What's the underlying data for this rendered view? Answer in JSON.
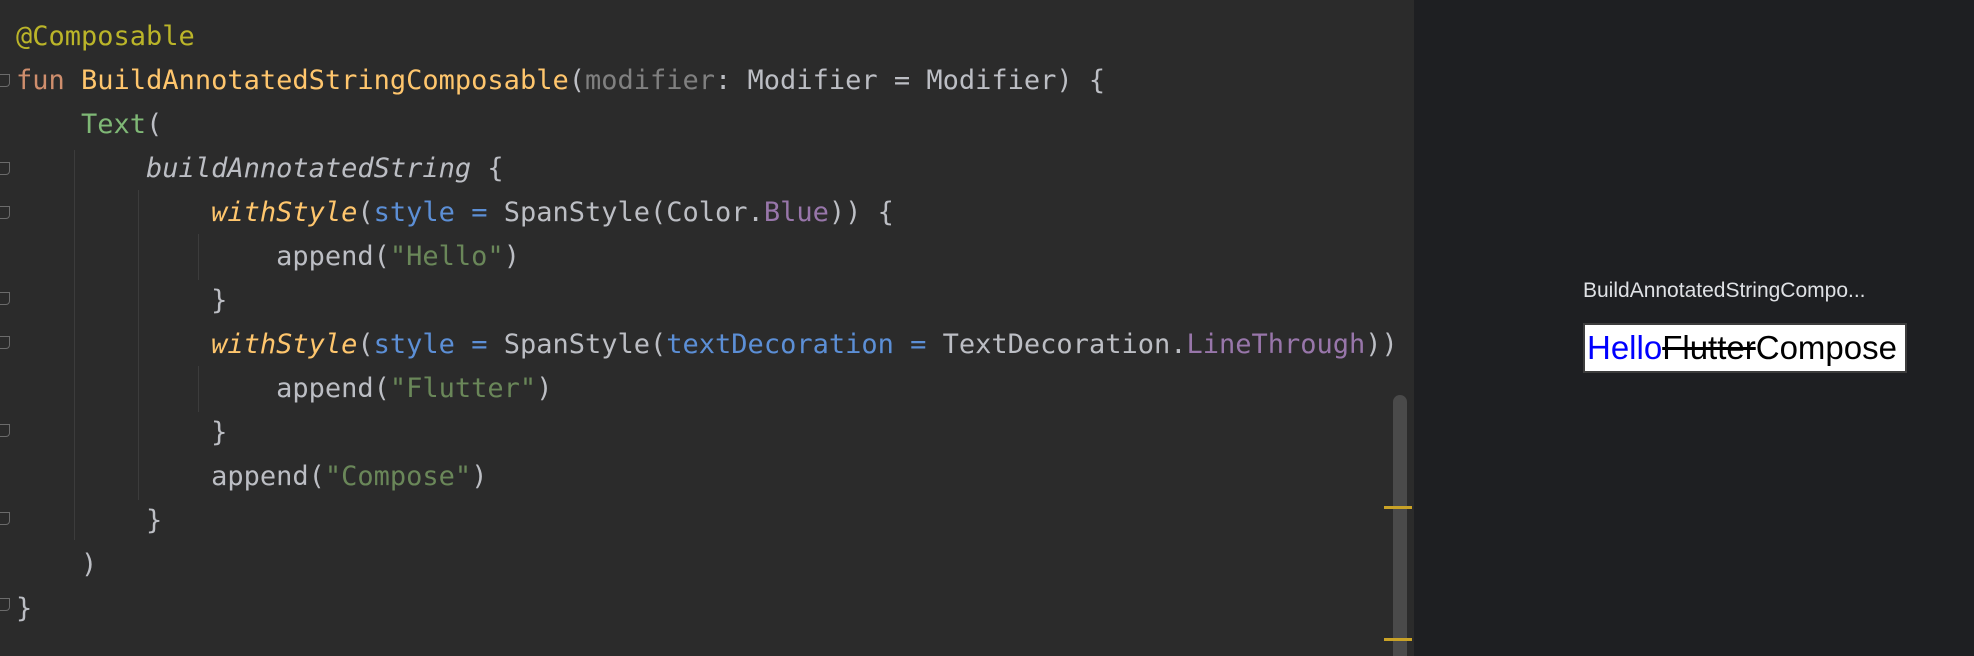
{
  "editor": {
    "lines": {
      "l1": {
        "annotation": "@Composable"
      },
      "l2": {
        "kw": "fun",
        "sp1": " ",
        "fn_name": "BuildAnnotatedStringComposable",
        "open": "(",
        "param": "modifier",
        "colon": ": ",
        "type": "Modifier",
        "eq": " = ",
        "default": "Modifier",
        "close": ") {"
      },
      "l3": {
        "indent": "    ",
        "call": "Text",
        "open": "("
      },
      "l4": {
        "indent": "        ",
        "call": "buildAnnotatedString",
        "brace": " {"
      },
      "l5": {
        "indent": "            ",
        "call": "withStyle",
        "open": "(",
        "arg": "style",
        "eq": " = ",
        "span": "SpanStyle(Color.",
        "prop": "Blue",
        "close": ")) {"
      },
      "l6": {
        "indent": "                ",
        "call": "append(",
        "str": "\"Hello\"",
        "close": ")"
      },
      "l7": {
        "indent": "            ",
        "brace": "}"
      },
      "l8": {
        "indent": "            ",
        "call": "withStyle",
        "open": "(",
        "arg": "style",
        "eq": " = ",
        "span": "SpanStyle(",
        "arg2": "textDecoration",
        "eq2": " = ",
        "cls": "TextDecoration.",
        "prop": "LineThrough",
        "close": ")) {"
      },
      "l9": {
        "indent": "                ",
        "call": "append(",
        "str": "\"Flutter\"",
        "close": ")"
      },
      "l10": {
        "indent": "            ",
        "brace": "}"
      },
      "l11": {
        "indent": "            ",
        "call": "append(",
        "str": "\"Compose\"",
        "close": ")"
      },
      "l12": {
        "indent": "        ",
        "brace": "}"
      },
      "l13": {
        "indent": "    ",
        "paren": ")"
      },
      "l14": {
        "brace": "}"
      }
    }
  },
  "preview": {
    "title": "BuildAnnotatedStringCompo...",
    "hello": "Hello",
    "flutter": "Flutter",
    "compose": "Compose"
  },
  "colors": {
    "editor_bg": "#2b2b2b",
    "preview_bg": "#1e1f22",
    "annotation": "#bbb529",
    "keyword": "#cf8e6d",
    "function": "#ffc66d",
    "string": "#6a8759",
    "named_arg": "#5c8fd6",
    "property": "#9876aa",
    "marker": "#c9a227",
    "hello_text": "#0000ff"
  }
}
